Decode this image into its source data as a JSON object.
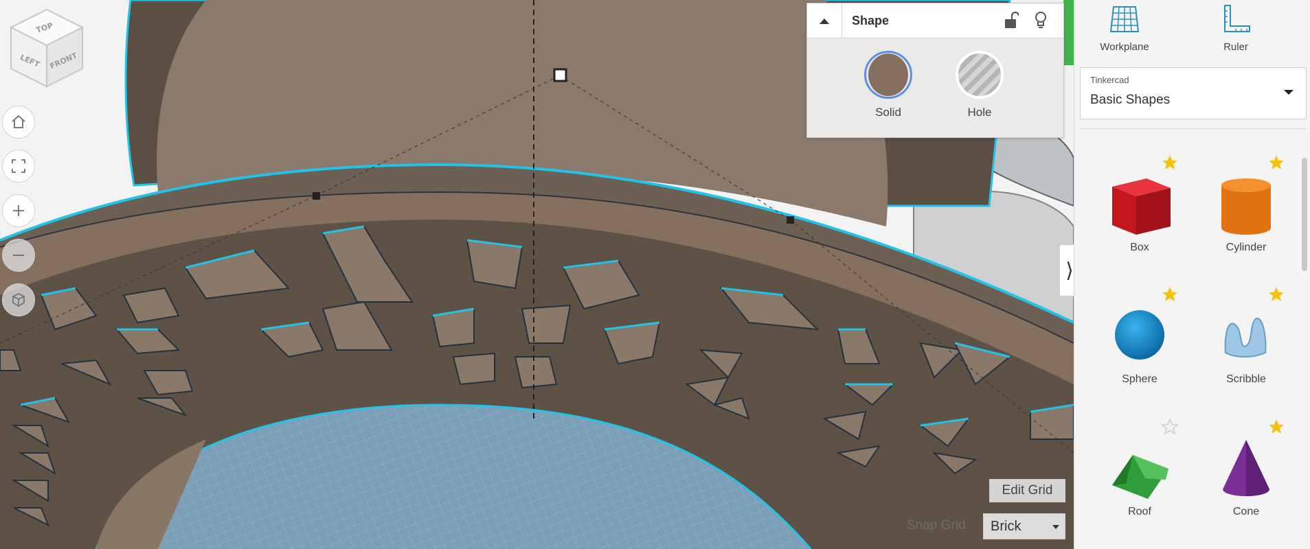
{
  "viewcube": {
    "top": "TOP",
    "left": "LEFT",
    "front": "FRONT"
  },
  "nav": {
    "home": "home-icon",
    "fit": "fit-to-view-icon",
    "zoom_in": "plus-icon",
    "zoom_out": "minus-icon",
    "projection": "perspective-cube-icon"
  },
  "shape_panel": {
    "title": "Shape",
    "solid_label": "Solid",
    "hole_label": "Hole",
    "solid_color": "#85705f",
    "outline_color": "#22c3e6"
  },
  "sidebar": {
    "tools": [
      {
        "label": "Workplane",
        "icon": "workplane-grid-icon"
      },
      {
        "label": "Ruler",
        "icon": "ruler-icon"
      }
    ],
    "category": {
      "library": "Tinkercad",
      "selected": "Basic Shapes"
    },
    "shapes": [
      {
        "name": "Box",
        "favorite": true
      },
      {
        "name": "Cylinder",
        "favorite": true
      },
      {
        "name": "Sphere",
        "favorite": true
      },
      {
        "name": "Scribble",
        "favorite": true
      },
      {
        "name": "Roof",
        "favorite": false
      },
      {
        "name": "Cone",
        "favorite": true
      }
    ]
  },
  "grid": {
    "edit_label": "Edit Grid",
    "snap_label": "Snap Grid",
    "snap_value": "Brick"
  }
}
